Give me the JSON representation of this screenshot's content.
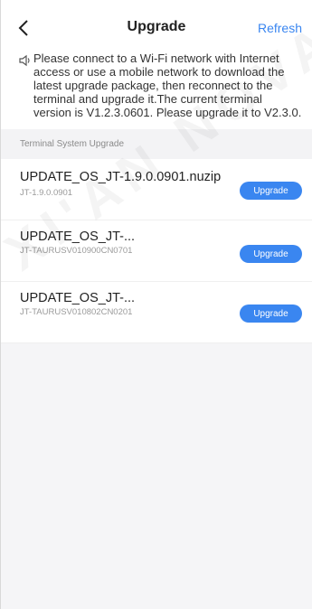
{
  "header": {
    "title": "Upgrade",
    "refresh_label": "Refresh",
    "back_icon": "chevron-left-icon"
  },
  "notice": {
    "icon": "speaker-icon",
    "text": "Please connect to a Wi-Fi network with Internet access or use a mobile network to download the latest upgrade package, then reconnect to the terminal and upgrade it.The current terminal version is V1.2.3.0601. Please upgrade it to V2.3.0."
  },
  "section": {
    "title": "Terminal System Upgrade"
  },
  "packages": [
    {
      "name": "UPDATE_OS_JT-1.9.0.0901.nuzip",
      "version": "JT-1.9.0.0901",
      "button": "Upgrade"
    },
    {
      "name": "UPDATE_OS_JT-...",
      "version": "JT-TAURUSV010900CN0701",
      "button": "Upgrade"
    },
    {
      "name": "UPDATE_OS_JT-...",
      "version": "JT-TAURUSV010802CN0201",
      "button": "Upgrade"
    }
  ],
  "watermark": "XI'AN NOVA",
  "colors": {
    "accent": "#3a86f0",
    "background": "#f5f5f7",
    "text": "#222222",
    "muted": "#9a9a9a"
  }
}
